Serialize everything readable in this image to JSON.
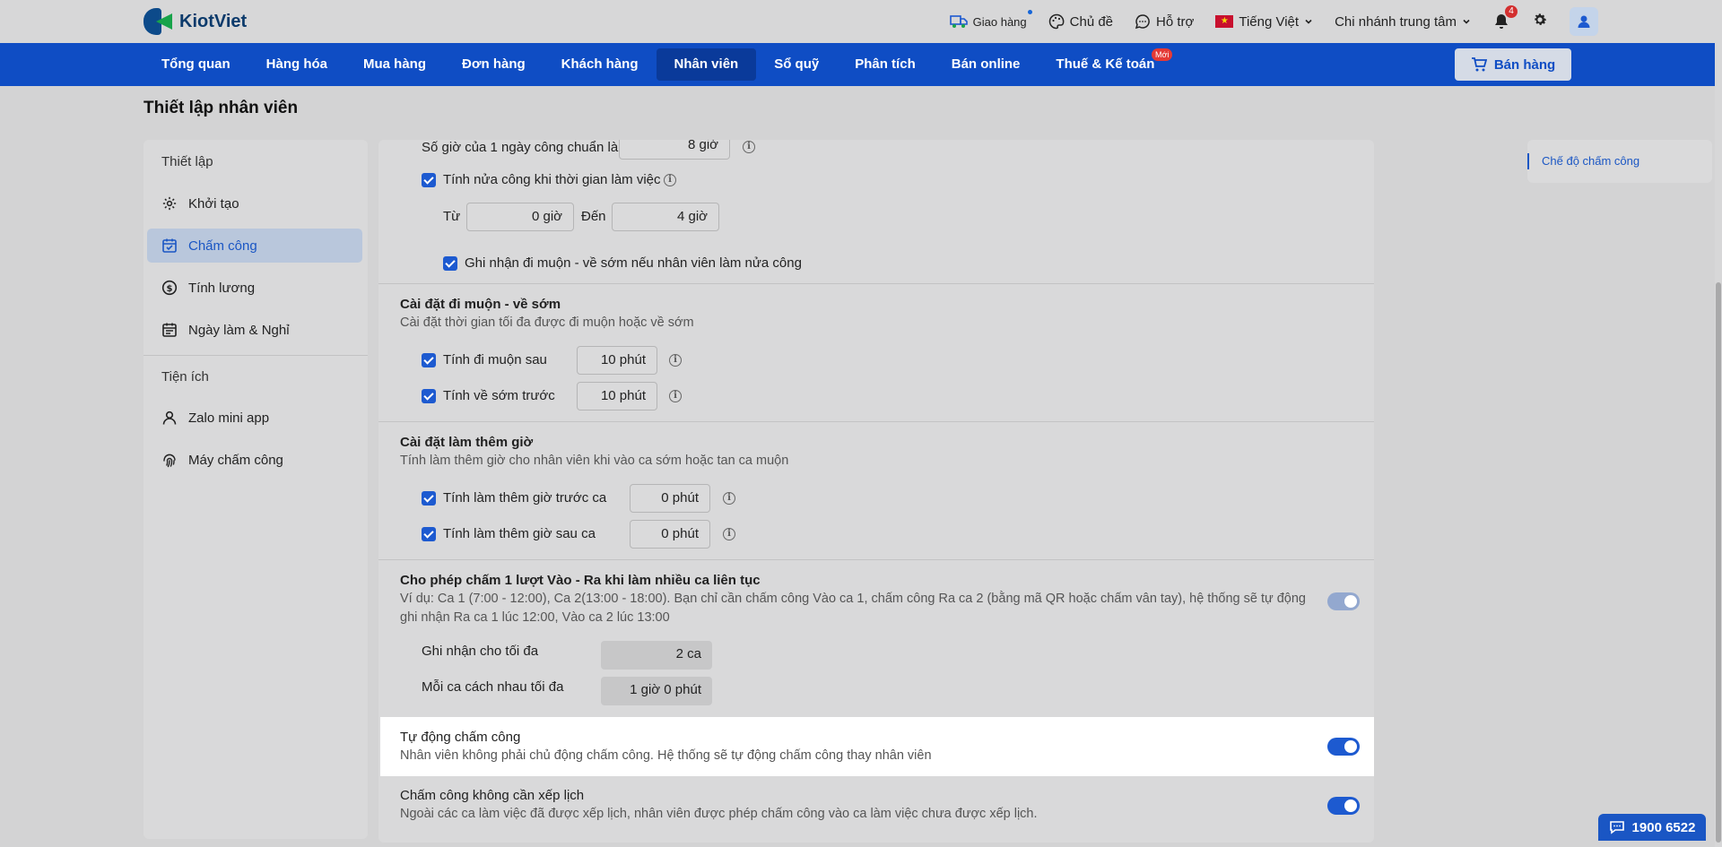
{
  "app": {
    "brand": "KiotViet"
  },
  "topbar": {
    "delivery": "Giao hàng",
    "theme": "Chủ đề",
    "support": "Hỗ trợ",
    "language": "Tiếng Việt",
    "branch": "Chi nhánh trung tâm",
    "notification_count": "4",
    "flag_star": "★"
  },
  "nav": {
    "items": [
      "Tổng quan",
      "Hàng hóa",
      "Mua hàng",
      "Đơn hàng",
      "Khách hàng",
      "Nhân viên",
      "Sổ quỹ",
      "Phân tích",
      "Bán online",
      "Thuế & Kế toán"
    ],
    "active": "Nhân viên",
    "new_badge": "Mới",
    "sell_button": "Bán hàng"
  },
  "page": {
    "title": "Thiết lập nhân viên"
  },
  "sidebar": {
    "group1": "Thiết lập",
    "items1": [
      "Khởi tạo",
      "Chấm công",
      "Tính lương",
      "Ngày làm & Nghỉ"
    ],
    "group2": "Tiện ích",
    "items2": [
      "Zalo mini app",
      "Máy chấm công"
    ]
  },
  "standard_day": {
    "label": "Số giờ của 1 ngày công chuẩn là",
    "value": "8 giờ"
  },
  "half_day": {
    "label": "Tính nửa công khi thời gian làm việc",
    "from_label": "Từ",
    "from_value": "0 giờ",
    "to_label": "Đến",
    "to_value": "4 giờ",
    "record_late_label": "Ghi nhận đi muộn - về sớm nếu nhân viên làm nửa công"
  },
  "late_early": {
    "title": "Cài đặt đi muộn - về sớm",
    "desc": "Cài đặt thời gian tối đa được đi muộn hoặc về sớm",
    "late_label": "Tính đi muộn sau",
    "late_value": "10 phút",
    "early_label": "Tính về sớm trước",
    "early_value": "10 phút"
  },
  "overtime": {
    "title": "Cài đặt làm thêm giờ",
    "desc": "Tính làm thêm giờ cho nhân viên khi vào ca sớm hoặc tan ca muộn",
    "before_label": "Tính làm thêm giờ trước ca",
    "before_value": "0 phút",
    "after_label": "Tính làm thêm giờ sau ca",
    "after_value": "0 phút"
  },
  "multi_shift": {
    "title": "Cho phép chấm 1 lượt Vào - Ra khi làm nhiều ca liên tục",
    "desc1": "Ví dụ: Ca 1 (7:00 - 12:00), Ca 2(13:00 - 18:00). Bạn chỉ cần chấm công Vào ca 1, chấm công Ra ca 2 (bằng mã QR hoặc chấm vân tay), hệ thống sẽ tự động",
    "desc2": "ghi nhận Ra ca 1 lúc 12:00, Vào ca 2 lúc 13:00",
    "max_label": "Ghi nhận cho tối đa",
    "max_value": "2 ca",
    "gap_label": "Mỗi ca cách nhau tối đa",
    "gap_value": "1 giờ 0 phút"
  },
  "auto_attendance": {
    "title": "Tự động chấm công",
    "desc": "Nhân viên không phải chủ động chấm công. Hệ thống sẽ tự động chấm công thay nhân viên"
  },
  "no_schedule": {
    "title": "Chấm công không cần xếp lịch",
    "desc": "Ngoài các ca làm việc đã được xếp lịch, nhân viên được phép chấm công vào ca làm việc chưa được xếp lịch."
  },
  "anchor": {
    "link": "Chế độ chấm công"
  },
  "hotline": "1900 6522",
  "colors": {
    "primary": "#0f4dc4",
    "accent": "#1a56c4",
    "badge": "#d32f2f"
  }
}
